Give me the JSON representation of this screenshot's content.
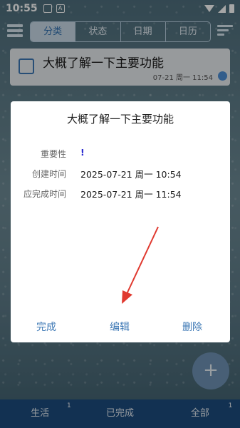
{
  "status_bar": {
    "time": "10:55"
  },
  "tabs": [
    {
      "label": "分类",
      "active": true
    },
    {
      "label": "状态",
      "active": false
    },
    {
      "label": "日期",
      "active": false
    },
    {
      "label": "日历",
      "active": false
    }
  ],
  "task": {
    "title": "大概了解一下主要功能",
    "meta": "07-21 周一 11:54",
    "dot_color": "#4d8fd6"
  },
  "dialog": {
    "title": "大概了解一下主要功能",
    "rows": [
      {
        "label": "重要性",
        "value": "!"
      },
      {
        "label": "创建时间",
        "value": "2025-07-21 周一 10:54"
      },
      {
        "label": "应完成时间",
        "value": "2025-07-21 周一 11:54"
      }
    ],
    "buttons": {
      "complete": "完成",
      "edit": "编辑",
      "delete": "删除"
    }
  },
  "fab_label": "+",
  "bottom_nav": [
    {
      "label": "生活",
      "badge": "1"
    },
    {
      "label": "已完成",
      "badge": ""
    },
    {
      "label": "全部",
      "badge": "1"
    }
  ],
  "colors": {
    "accent": "#3d78b5",
    "bottom_bar": "#1c4c7f",
    "arrow": "#e0392f"
  }
}
